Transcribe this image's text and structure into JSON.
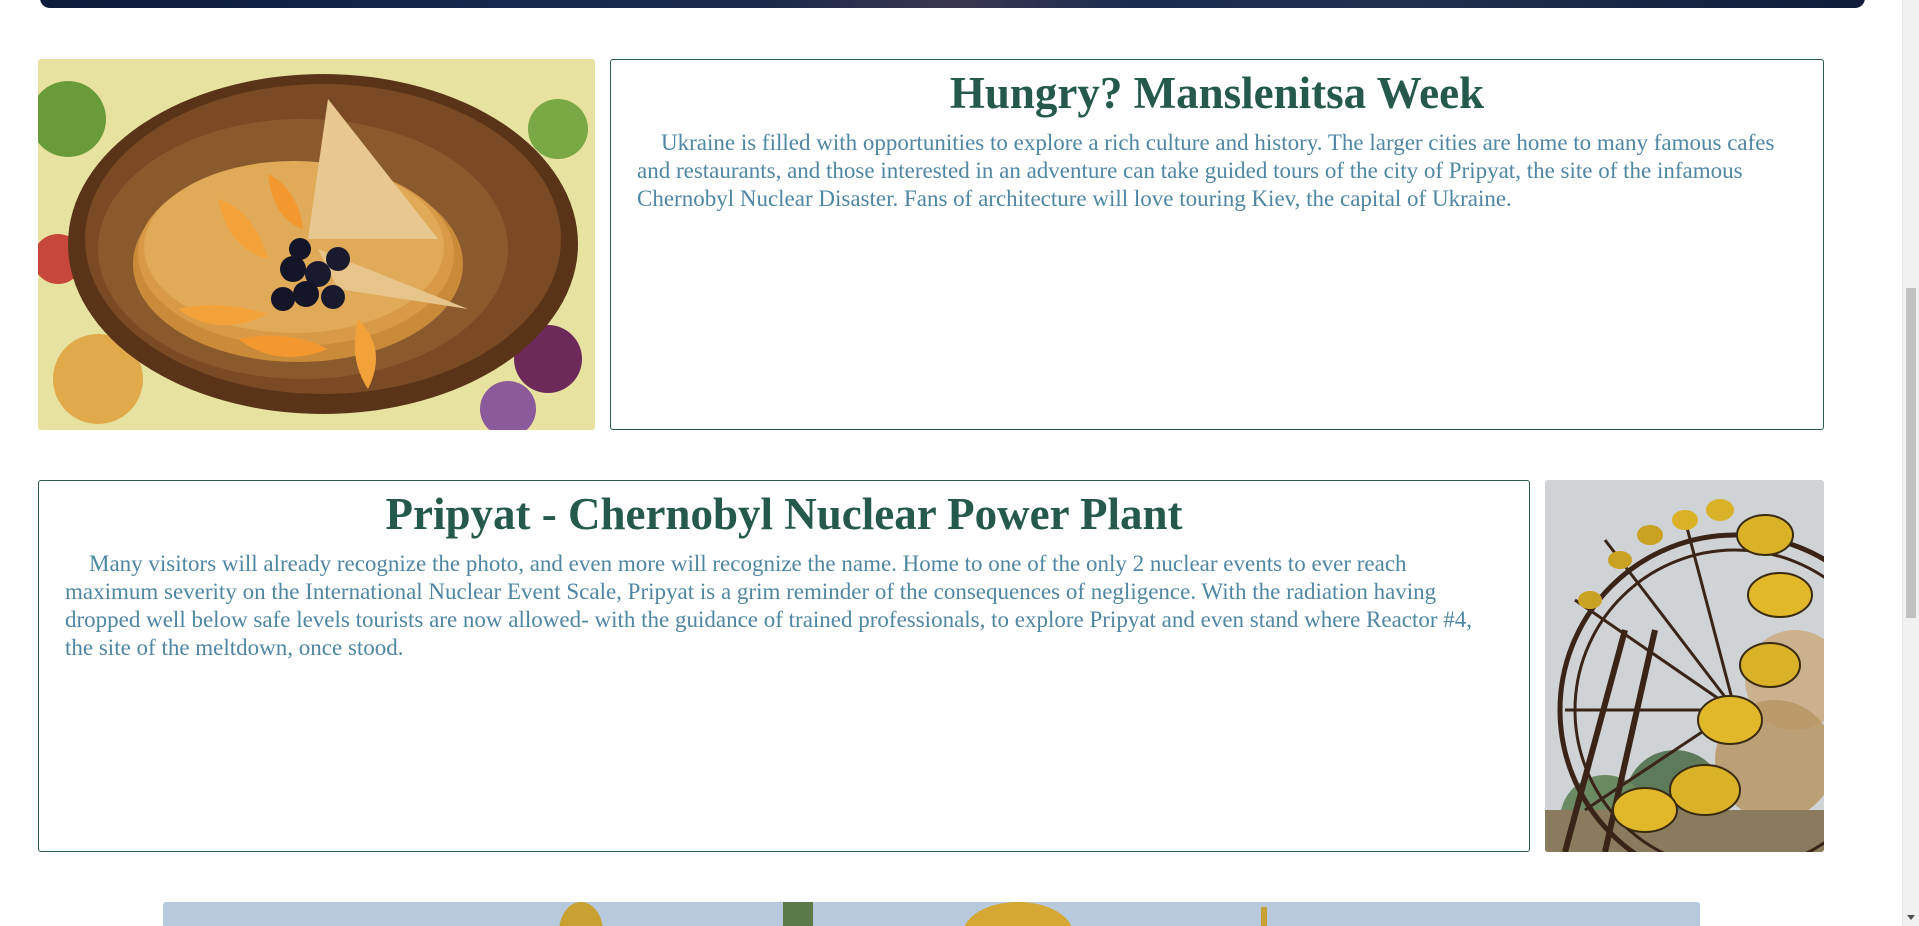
{
  "sections": [
    {
      "title": "Hungry? Manslenitsa Week",
      "body": "Ukraine is filled with opportunities to explore a rich culture and history. The larger cities are home to many famous cafes and restaurants, and those interested in an adventure can take guided tours of the city of Pripyat, the site of the infamous Chernobyl Nuclear Disaster. Fans of architecture will love touring Kiev, the capital of Ukraine.",
      "image": "pancakes-photo"
    },
    {
      "title": "Pripyat - Chernobyl Nuclear Power Plant",
      "body": "Many visitors will already recognize the photo, and even more will recognize the name. Home to one of the only 2 nuclear events to ever reach maximum severity on the International Nuclear Event Scale, Pripyat is a grim reminder of the consequences of negligence. With the radiation having dropped well below safe levels tourists are now allowed- with the guidance of trained professionals, to explore Pripyat and even stand where Reactor #4, the site of the meltdown, once stood.",
      "image": "ferris-wheel-photo"
    }
  ],
  "colors": {
    "heading": "#24594c",
    "body_text": "#4f86a3",
    "border": "#2a5a4e"
  }
}
